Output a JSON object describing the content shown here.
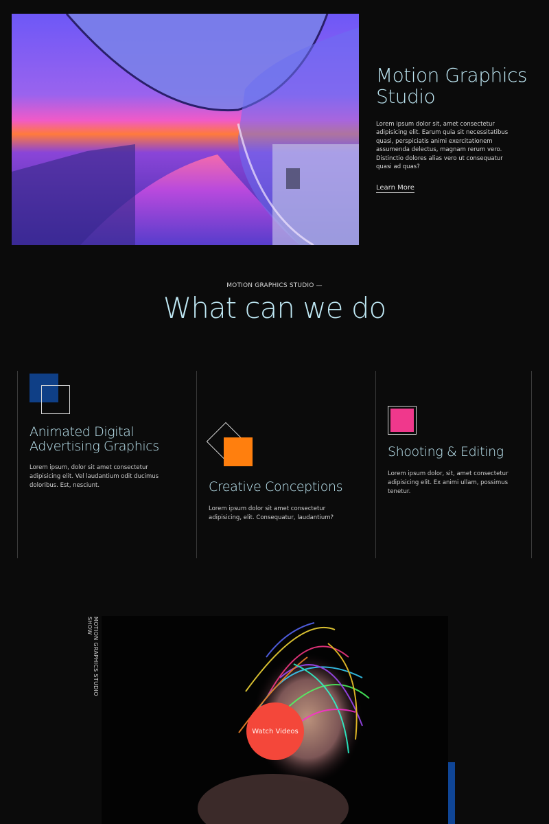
{
  "hero": {
    "title": "Motion Graphics Studio",
    "body": "Lorem ipsum dolor sit, amet consectetur adipisicing elit. Earum quia sit necessitatibus quasi, perspiciatis animi exercitationem assumenda delectus, magnam rerum vero. Distinctio dolores alias vero ut consequatur quasi ad quas?",
    "link_label": "Learn More"
  },
  "services_section": {
    "kicker": "MOTION GRAPHICS STUDIO —",
    "title": "What can we do",
    "items": [
      {
        "title": "Animated Digital Advertising Graphics",
        "body": "Lorem ipsum, dolor sit amet consectetur adipisicing elit. Vel laudantium odit ducimus doloribus. Est, nesciunt.",
        "icon": "blue-square-outline-icon",
        "accent_color": "#0f3f86"
      },
      {
        "title": "Creative Conceptions",
        "body": "Lorem ipsum dolor sit amet consectetur adipisicing, elit. Consequatur, laudantium?",
        "icon": "orange-square-diamond-icon",
        "accent_color": "#ff7f0e"
      },
      {
        "title": "Shooting & Editing",
        "body": "Lorem ipsum dolor, sit, amet consectetur adipisicing elit. Ex animi ullam, possimus tenetur.",
        "icon": "pink-square-outline-icon",
        "accent_color": "#f0388c"
      }
    ]
  },
  "video": {
    "side_label": "MOTION GRAPHICS STUDIO SHOW",
    "button_label": "Watch Videos",
    "button_color": "#f4473a"
  },
  "colors": {
    "background": "#0b0b0b",
    "heading": "#bfe8f4",
    "accent_blue": "#0f4596"
  }
}
